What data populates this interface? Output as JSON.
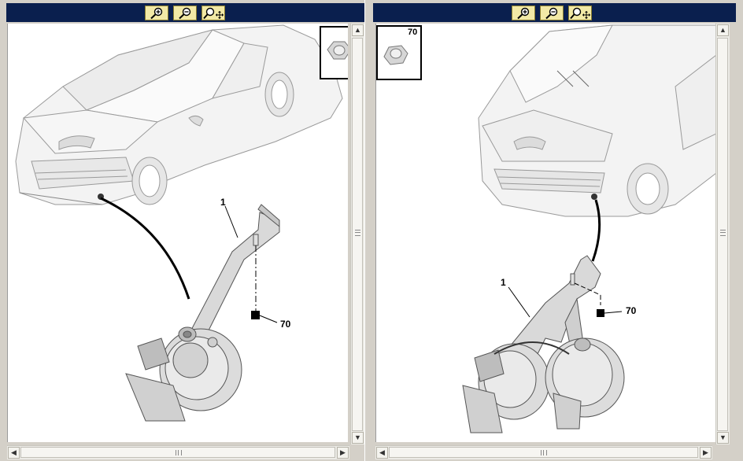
{
  "toolbar": {
    "zoom_in_icon": "magnifier-plus-icon",
    "zoom_out_icon": "magnifier-minus-icon",
    "pan_icon": "magnifier-move-icon",
    "colors": {
      "bar": "#0a1f4e",
      "button": "#f2e9a6"
    }
  },
  "left_diagram": {
    "callouts": [
      "1",
      "70"
    ],
    "view": "Single horn assembly on front bumper"
  },
  "right_diagram": {
    "thumbnail_label": "70",
    "callouts": [
      "1",
      "70"
    ]
  }
}
